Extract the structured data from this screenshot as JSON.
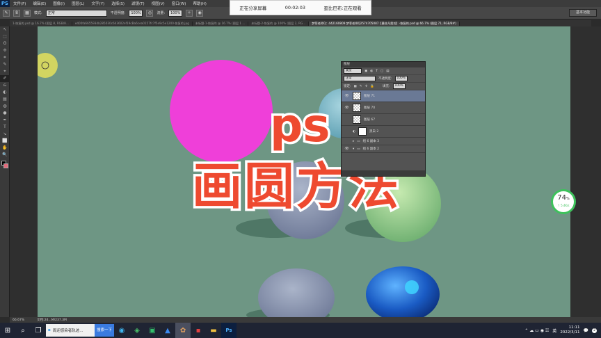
{
  "app": {
    "logo": "PS"
  },
  "menu": [
    "文件(F)",
    "编辑(E)",
    "图像(I)",
    "图层(L)",
    "文字(Y)",
    "选择(S)",
    "滤镜(T)",
    "视图(V)",
    "窗口(W)",
    "帮助(H)"
  ],
  "options": {
    "mode_label": "模式:",
    "mode_value": "正常",
    "opacity_label": "不透明度:",
    "opacity_value": "100%",
    "flow_label": "流量:",
    "flow_value": "100%",
    "brush_size": "8",
    "workspace": "基本功能"
  },
  "share_banner": {
    "status": "正在分享屏幕",
    "timer": "00:02:03",
    "viewer": "歪比巴布:正在观看"
  },
  "tabs": [
    "1-恢复的.psd @ 16.7% (图层 8, RGB/8...",
    "e400fa6655934b285030c643602ef19cBa6cea0157fc7f5e9c5e1200-恢复的.jpg",
    "未标题-1-恢复的 @ 16.7% (图层 1 ...",
    "未标题-2-恢复的 @ 100% (图层 2, RG...",
    "梦菲老师Q：442160809 梦菲老师Q2574705087【墨非凡奥坊】-恢复的.psd @ 66.7% (图层 71, RGB/8#)"
  ],
  "tools": [
    "↖",
    "⬚",
    "ʘ",
    "✢",
    "⌗",
    "✎",
    "⌖",
    "✐",
    "⎌",
    "◐",
    "▤",
    "◍",
    "●",
    "✒",
    "T",
    "↘",
    "⬜",
    "✋",
    "🔍"
  ],
  "title_overlay": {
    "line1": "ps",
    "line2": "画圆方法"
  },
  "layers_panel": {
    "title": "图层",
    "kind_label": "类型",
    "blend_value": "正常",
    "opacity_label": "不透明度:",
    "opacity_value": "100%",
    "lock_label": "锁定:",
    "fill_label": "填充:",
    "fill_value": "100%",
    "rows": [
      {
        "name": "图层 71",
        "selected": true
      },
      {
        "name": "图层 70",
        "selected": false
      },
      {
        "name": "图层 67",
        "selected": false
      }
    ],
    "adjust_layer": "黑白 2",
    "groups": [
      "组 6 副本 3",
      "组 6 副本 2"
    ]
  },
  "status": {
    "zoom": "66.67%",
    "doc": "文档:24...M/237.3M"
  },
  "speed_badge": {
    "value": "74",
    "unit": "%",
    "rate": "↑ 5.4K/s"
  },
  "taskbar": {
    "search_text": "周迎感染者轨迹...",
    "search_button": "搜索一下",
    "ime": "英",
    "time": "11:11",
    "date": "2022/3/11",
    "notification_count": "2"
  },
  "colors": {
    "canvas": "#6e9684",
    "magenta_circle": "#ef3fd9",
    "title_red": "#ee4a30",
    "selection": "#6a7995"
  }
}
